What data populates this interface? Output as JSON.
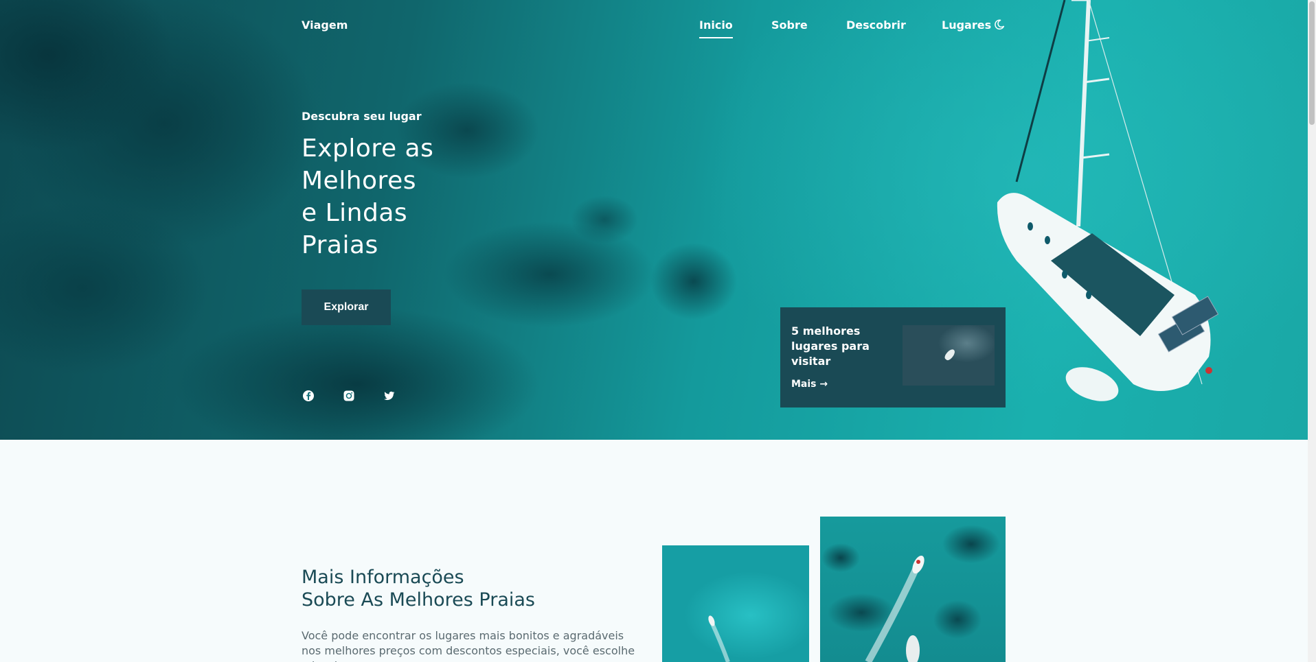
{
  "nav": {
    "logo": "Viagem",
    "items": [
      {
        "label": "Inicio",
        "active": true
      },
      {
        "label": "Sobre",
        "active": false
      },
      {
        "label": "Descobrir",
        "active": false
      },
      {
        "label": "Lugares",
        "active": false
      }
    ],
    "theme_icon": "moon-icon"
  },
  "hero": {
    "subtitle": "Descubra seu lugar",
    "title_lines": [
      "Explore as",
      "Melhores",
      "e Lindas",
      "Praias"
    ],
    "button": "Explorar",
    "social_icons": [
      "facebook-icon",
      "instagram-icon",
      "twitter-icon"
    ],
    "card": {
      "title": "5 melhores lugares para visitar",
      "link": "Mais"
    }
  },
  "about": {
    "title_lines": [
      "Mais Informações",
      "Sobre As Melhores Praias"
    ],
    "text": "Você pode encontrar os lugares mais bonitos e agradáveis nos melhores preços com descontos especiais, você escolhe o local"
  },
  "colors": {
    "accent": "#1a4a55",
    "hero_water": "#1aa9ad",
    "text_muted": "#5a6a70"
  }
}
